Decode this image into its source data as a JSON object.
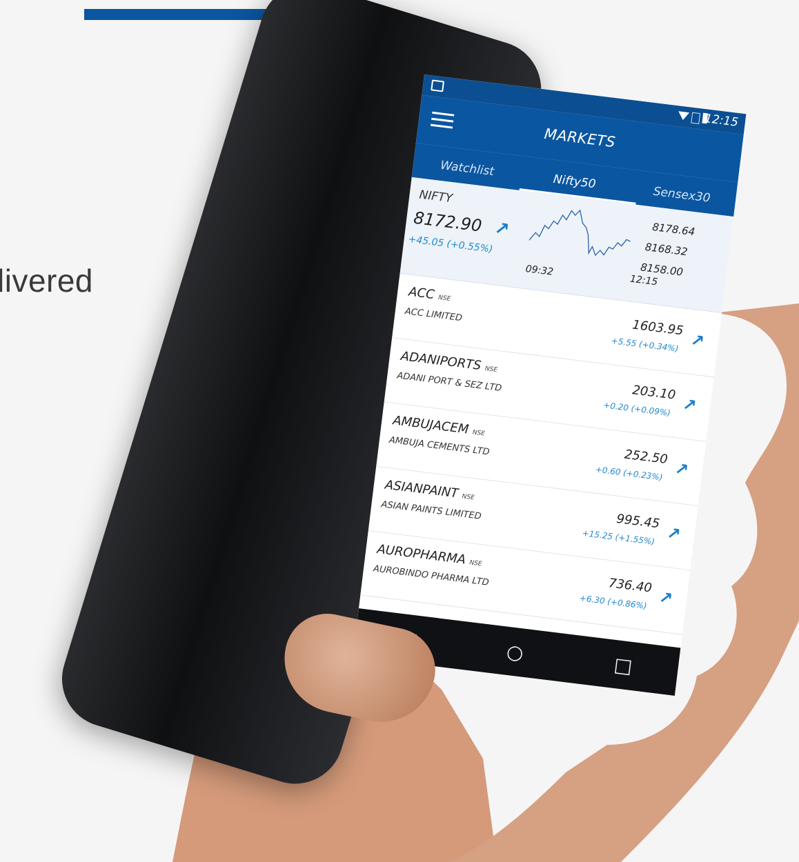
{
  "background": {
    "accent_color": "#0b56a0",
    "text_fragment": "livered"
  },
  "status_bar": {
    "time": "12:15",
    "icons": [
      "image-icon",
      "wifi-icon",
      "no-sim-icon",
      "battery-icon"
    ]
  },
  "header": {
    "title": "MARKETS",
    "menu_icon": "hamburger-icon"
  },
  "tabs": [
    {
      "label": "Watchlist",
      "active": false
    },
    {
      "label": "Nifty50",
      "active": true
    },
    {
      "label": "Sensex30",
      "active": false
    }
  ],
  "index_card": {
    "name": "NIFTY",
    "value": "8172.90",
    "change": "+45.05 (+0.55%)",
    "high": "8178.64",
    "last": "8168.32",
    "low": "8158.00",
    "time_start": "09:32",
    "time_end": "12:15",
    "trend_icon": "arrow-up-right-icon"
  },
  "stocks": [
    {
      "symbol": "ACC",
      "exchange": "NSE",
      "company": "ACC LIMITED",
      "price": "1603.95",
      "change": "+5.55 (+0.34%)"
    },
    {
      "symbol": "ADANIPORTS",
      "exchange": "NSE",
      "company": "ADANI PORT & SEZ LTD",
      "price": "203.10",
      "change": "+0.20 (+0.09%)"
    },
    {
      "symbol": "AMBUJACEM",
      "exchange": "NSE",
      "company": "AMBUJA CEMENTS LTD",
      "price": "252.50",
      "change": "+0.60 (+0.23%)"
    },
    {
      "symbol": "ASIANPAINT",
      "exchange": "NSE",
      "company": "ASIAN PAINTS LIMITED",
      "price": "995.45",
      "change": "+15.25 (+1.55%)"
    },
    {
      "symbol": "AUROPHARMA",
      "exchange": "NSE",
      "company": "AUROBINDO PHARMA LTD",
      "price": "736.40",
      "change": "+6.30 (+0.86%)"
    }
  ],
  "nav_bar": {
    "back": "◁",
    "home": "○",
    "recents": "□"
  },
  "colors": {
    "primary": "#0b56a0",
    "status_bar": "#0b4f92",
    "positive": "#1e88d0"
  }
}
